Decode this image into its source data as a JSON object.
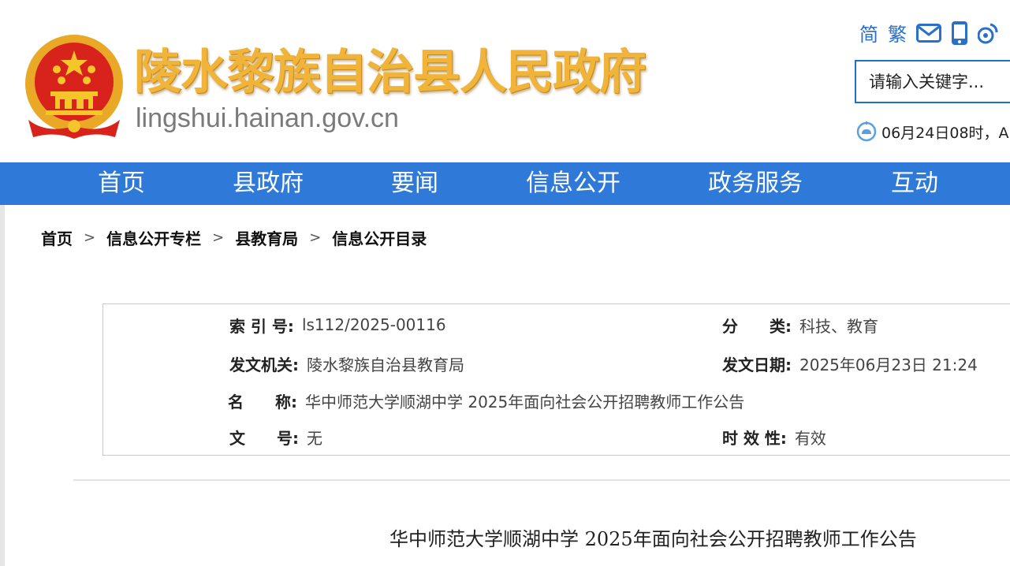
{
  "header": {
    "title": "陵水黎族自治县人民政府",
    "domain": "lingshui.hainan.gov.cn",
    "tools": {
      "simplified": "简",
      "traditional": "繁"
    },
    "icons": [
      "emblem-icon",
      "mail-icon",
      "mobile-icon",
      "weibo-icon",
      "weather-icon"
    ],
    "search": {
      "placeholder": "请输入关键字..."
    },
    "weather": "06月24日08时，A"
  },
  "nav": {
    "items": [
      {
        "label": "首页"
      },
      {
        "label": "县政府"
      },
      {
        "label": "要闻"
      },
      {
        "label": "信息公开"
      },
      {
        "label": "政务服务"
      },
      {
        "label": "互动"
      }
    ]
  },
  "breadcrumb": {
    "items": [
      {
        "label": "首页"
      },
      {
        "label": "信息公开专栏"
      },
      {
        "label": "县教育局"
      },
      {
        "label": "信息公开目录"
      }
    ],
    "separator": ">"
  },
  "info": {
    "index_label": "索 引 号:",
    "index_value": "ls112/2025-00116",
    "category_label": "分　　类:",
    "category_value": "科技、教育",
    "issuer_label": "发文机关:",
    "issuer_value": "陵水黎族自治县教育局",
    "date_label": "发文日期:",
    "date_value": "2025年06月23日 21:24",
    "name_label": "名　　称:",
    "name_value": "华中师范大学顺湖中学 2025年面向社会公开招聘教师工作公告",
    "docno_label": "文　　号:",
    "docno_value": "无",
    "validity_label": "时 效 性:",
    "validity_value": "有效"
  },
  "article": {
    "title": "华中师范大学顺湖中学 2025年面向社会公开招聘教师工作公告"
  },
  "colors": {
    "nav_bg": "#2f7ad9",
    "title_gold": "#f0b43a",
    "link_blue": "#2a6fc9",
    "emblem_red": "#d8231c"
  }
}
